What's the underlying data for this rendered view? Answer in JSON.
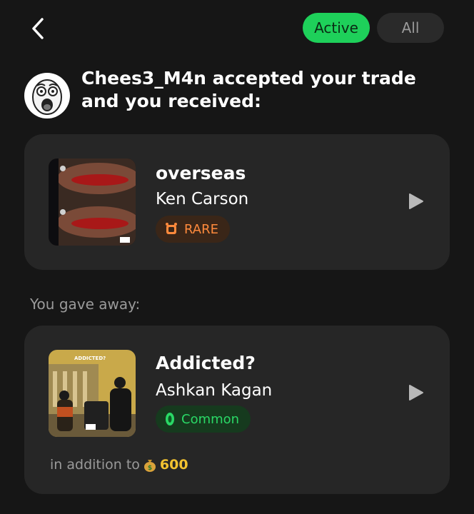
{
  "segments": {
    "active_label": "Active",
    "all_label": "All",
    "selected": "Active"
  },
  "header": {
    "message": "Chees3_M4n accepted your trade and you received:"
  },
  "received": {
    "title": "overseas",
    "artist": "Ken Carson",
    "rarity": "RARE",
    "rarity_icon": "alarm-clock-icon"
  },
  "gave_label": "You gave away:",
  "gave": {
    "title": "Addicted?",
    "artist": "Ashkan Kagan",
    "rarity": "Common",
    "rarity_icon": "gem-icon",
    "cover_text": "ADDICTED?",
    "extra_prefix": "in addition to",
    "coins_icon": "money-bag-icon",
    "coins": "600"
  },
  "colors": {
    "background": "#161616",
    "card": "#262626",
    "accent_green": "#1ed05a",
    "rare": "#ff8a3c",
    "common": "#2ad866",
    "coins": "#f2c230"
  }
}
